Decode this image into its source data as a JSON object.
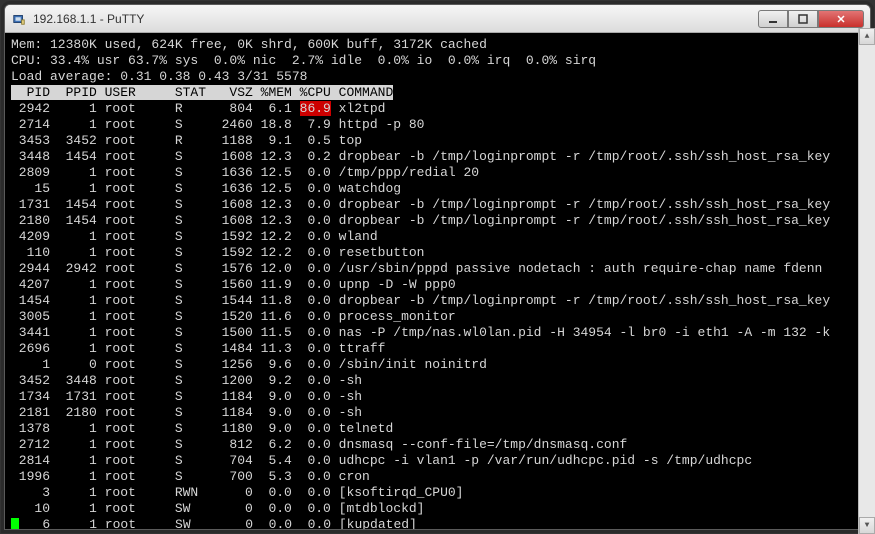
{
  "window": {
    "title": "192.168.1.1 - PuTTY"
  },
  "summary": {
    "mem": "Mem: 12380K used, 624K free, 0K shrd, 600K buff, 3172K cached",
    "cpu": "CPU: 33.4% usr 63.7% sys  0.0% nic  2.7% idle  0.0% io  0.0% irq  0.0% sirq",
    "load": "Load average: 0.31 0.38 0.43 3/31 5578"
  },
  "header": "  PID  PPID USER     STAT   VSZ %MEM %CPU COMMAND",
  "rows": [
    {
      "pid": " 2942",
      "ppid": "    1",
      "user": "root    ",
      "stat": "R   ",
      "vsz": "   804",
      "mem": " 6.1",
      "cpu": "86.9",
      "cmd": "xl2tpd",
      "hl": true
    },
    {
      "pid": " 2714",
      "ppid": "    1",
      "user": "root    ",
      "stat": "S   ",
      "vsz": "  2460",
      "mem": "18.8",
      "cpu": " 7.9",
      "cmd": "httpd -p 80"
    },
    {
      "pid": " 3453",
      "ppid": " 3452",
      "user": "root    ",
      "stat": "R   ",
      "vsz": "  1188",
      "mem": " 9.1",
      "cpu": " 0.5",
      "cmd": "top"
    },
    {
      "pid": " 3448",
      "ppid": " 1454",
      "user": "root    ",
      "stat": "S   ",
      "vsz": "  1608",
      "mem": "12.3",
      "cpu": " 0.2",
      "cmd": "dropbear -b /tmp/loginprompt -r /tmp/root/.ssh/ssh_host_rsa_key"
    },
    {
      "pid": " 2809",
      "ppid": "    1",
      "user": "root    ",
      "stat": "S   ",
      "vsz": "  1636",
      "mem": "12.5",
      "cpu": " 0.0",
      "cmd": "/tmp/ppp/redial 20"
    },
    {
      "pid": "   15",
      "ppid": "    1",
      "user": "root    ",
      "stat": "S   ",
      "vsz": "  1636",
      "mem": "12.5",
      "cpu": " 0.0",
      "cmd": "watchdog"
    },
    {
      "pid": " 1731",
      "ppid": " 1454",
      "user": "root    ",
      "stat": "S   ",
      "vsz": "  1608",
      "mem": "12.3",
      "cpu": " 0.0",
      "cmd": "dropbear -b /tmp/loginprompt -r /tmp/root/.ssh/ssh_host_rsa_key"
    },
    {
      "pid": " 2180",
      "ppid": " 1454",
      "user": "root    ",
      "stat": "S   ",
      "vsz": "  1608",
      "mem": "12.3",
      "cpu": " 0.0",
      "cmd": "dropbear -b /tmp/loginprompt -r /tmp/root/.ssh/ssh_host_rsa_key"
    },
    {
      "pid": " 4209",
      "ppid": "    1",
      "user": "root    ",
      "stat": "S   ",
      "vsz": "  1592",
      "mem": "12.2",
      "cpu": " 0.0",
      "cmd": "wland"
    },
    {
      "pid": "  110",
      "ppid": "    1",
      "user": "root    ",
      "stat": "S   ",
      "vsz": "  1592",
      "mem": "12.2",
      "cpu": " 0.0",
      "cmd": "resetbutton"
    },
    {
      "pid": " 2944",
      "ppid": " 2942",
      "user": "root    ",
      "stat": "S   ",
      "vsz": "  1576",
      "mem": "12.0",
      "cpu": " 0.0",
      "cmd": "/usr/sbin/pppd passive nodetach : auth require-chap name fdenn"
    },
    {
      "pid": " 4207",
      "ppid": "    1",
      "user": "root    ",
      "stat": "S   ",
      "vsz": "  1560",
      "mem": "11.9",
      "cpu": " 0.0",
      "cmd": "upnp -D -W ppp0"
    },
    {
      "pid": " 1454",
      "ppid": "    1",
      "user": "root    ",
      "stat": "S   ",
      "vsz": "  1544",
      "mem": "11.8",
      "cpu": " 0.0",
      "cmd": "dropbear -b /tmp/loginprompt -r /tmp/root/.ssh/ssh_host_rsa_key"
    },
    {
      "pid": " 3005",
      "ppid": "    1",
      "user": "root    ",
      "stat": "S   ",
      "vsz": "  1520",
      "mem": "11.6",
      "cpu": " 0.0",
      "cmd": "process_monitor"
    },
    {
      "pid": " 3441",
      "ppid": "    1",
      "user": "root    ",
      "stat": "S   ",
      "vsz": "  1500",
      "mem": "11.5",
      "cpu": " 0.0",
      "cmd": "nas -P /tmp/nas.wl0lan.pid -H 34954 -l br0 -i eth1 -A -m 132 -k"
    },
    {
      "pid": " 2696",
      "ppid": "    1",
      "user": "root    ",
      "stat": "S   ",
      "vsz": "  1484",
      "mem": "11.3",
      "cpu": " 0.0",
      "cmd": "ttraff"
    },
    {
      "pid": "    1",
      "ppid": "    0",
      "user": "root    ",
      "stat": "S   ",
      "vsz": "  1256",
      "mem": " 9.6",
      "cpu": " 0.0",
      "cmd": "/sbin/init noinitrd"
    },
    {
      "pid": " 3452",
      "ppid": " 3448",
      "user": "root    ",
      "stat": "S   ",
      "vsz": "  1200",
      "mem": " 9.2",
      "cpu": " 0.0",
      "cmd": "-sh"
    },
    {
      "pid": " 1734",
      "ppid": " 1731",
      "user": "root    ",
      "stat": "S   ",
      "vsz": "  1184",
      "mem": " 9.0",
      "cpu": " 0.0",
      "cmd": "-sh"
    },
    {
      "pid": " 2181",
      "ppid": " 2180",
      "user": "root    ",
      "stat": "S   ",
      "vsz": "  1184",
      "mem": " 9.0",
      "cpu": " 0.0",
      "cmd": "-sh"
    },
    {
      "pid": " 1378",
      "ppid": "    1",
      "user": "root    ",
      "stat": "S   ",
      "vsz": "  1180",
      "mem": " 9.0",
      "cpu": " 0.0",
      "cmd": "telnetd"
    },
    {
      "pid": " 2712",
      "ppid": "    1",
      "user": "root    ",
      "stat": "S   ",
      "vsz": "   812",
      "mem": " 6.2",
      "cpu": " 0.0",
      "cmd": "dnsmasq --conf-file=/tmp/dnsmasq.conf"
    },
    {
      "pid": " 2814",
      "ppid": "    1",
      "user": "root    ",
      "stat": "S   ",
      "vsz": "   704",
      "mem": " 5.4",
      "cpu": " 0.0",
      "cmd": "udhcpc -i vlan1 -p /var/run/udhcpc.pid -s /tmp/udhcpc"
    },
    {
      "pid": " 1996",
      "ppid": "    1",
      "user": "root    ",
      "stat": "S   ",
      "vsz": "   700",
      "mem": " 5.3",
      "cpu": " 0.0",
      "cmd": "cron"
    },
    {
      "pid": "    3",
      "ppid": "    1",
      "user": "root    ",
      "stat": "RWN ",
      "vsz": "     0",
      "mem": " 0.0",
      "cpu": " 0.0",
      "cmd": "[ksoftirqd_CPU0]"
    },
    {
      "pid": "   10",
      "ppid": "    1",
      "user": "root    ",
      "stat": "SW  ",
      "vsz": "     0",
      "mem": " 0.0",
      "cpu": " 0.0",
      "cmd": "[mtdblockd]"
    },
    {
      "pid": "    6",
      "ppid": "    1",
      "user": "root    ",
      "stat": "SW  ",
      "vsz": "     0",
      "mem": " 0.0",
      "cpu": " 0.0",
      "cmd": "[kupdated]"
    }
  ]
}
